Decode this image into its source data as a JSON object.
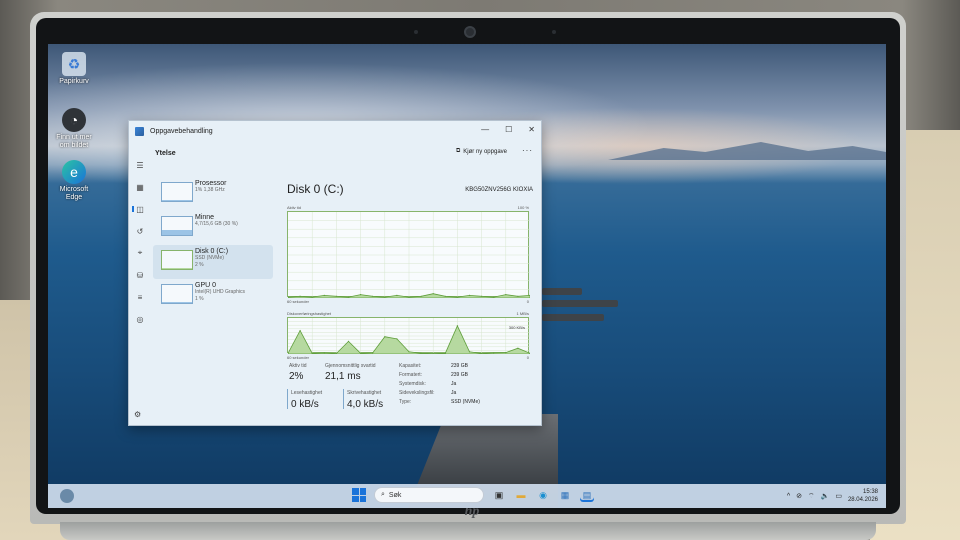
{
  "desktop": {
    "icons": [
      {
        "label": "Papirkurv",
        "icon": "recycle-bin-icon"
      },
      {
        "label": "Finn ut mer om bildet",
        "icon": "spotlight-icon"
      },
      {
        "label": "Microsoft Edge",
        "icon": "edge-icon"
      }
    ]
  },
  "task_manager": {
    "title": "Oppgavebehandling",
    "window_controls": [
      "—",
      "☐",
      "✕"
    ],
    "section_title": "Ytelse",
    "run_task": "Kjør ny oppgave",
    "more": "···",
    "rail_icons": [
      "☰",
      "▦",
      "◫",
      "↺",
      "⌖",
      "⛁",
      "≡",
      "◎"
    ],
    "settings_icon": "⚙",
    "items": [
      {
        "name": "Prosessor",
        "sub1": "1% 1,38 GHz",
        "sub2": "",
        "level": 0.01
      },
      {
        "name": "Minne",
        "sub1": "4,7/15,6 GB (30 %)",
        "sub2": "",
        "level": 0.3
      },
      {
        "name": "Disk 0 (C:)",
        "sub1": "SSD (NVMe)",
        "sub2": "2 %",
        "level": 0.02
      },
      {
        "name": "GPU 0",
        "sub1": "Intel(R) UHD Graphics",
        "sub2": "1 %",
        "level": 0.01
      }
    ],
    "disk": {
      "title": "Disk 0 (C:)",
      "model": "KBG50ZNV256G KIOXIA",
      "active_time_label": "Aktiv tid",
      "active_time_max": "100 %",
      "axis_left": "60 sekunder",
      "axis_right_zero": "0",
      "transfer_label": "Diskoverføringshastighet",
      "transfer_max": "1 MB/s",
      "transfer_mid": "300 KB/s",
      "stats": {
        "aktiv_tid_label": "Aktiv tid",
        "aktiv_tid": "2%",
        "avg_resp_label": "Gjennomsnittlig svartid",
        "avg_resp": "21,1 ms",
        "read_label": "Lesehastighet",
        "read": "0 kB/s",
        "write_label": "Skrivehastighet",
        "write": "4,0 kB/s"
      },
      "props": [
        {
          "k": "Kapasitet:",
          "v": "239 GB"
        },
        {
          "k": "Formatert:",
          "v": "239 GB"
        },
        {
          "k": "Systemdisk:",
          "v": "Ja"
        },
        {
          "k": "Sidevekslingsfil:",
          "v": "Ja"
        },
        {
          "k": "Type:",
          "v": "SSD (NVMe)"
        }
      ]
    }
  },
  "chart_data": [
    {
      "type": "area",
      "title": "Aktiv tid",
      "ylim": [
        0,
        100
      ],
      "xlabel": "60 sekunder",
      "x": [
        0,
        3,
        6,
        9,
        12,
        15,
        18,
        21,
        24,
        27,
        30,
        33,
        36,
        39,
        42,
        45,
        48,
        51,
        54,
        57,
        60
      ],
      "values": [
        1,
        2,
        1,
        3,
        2,
        1,
        4,
        2,
        1,
        3,
        1,
        2,
        5,
        2,
        1,
        3,
        2,
        1,
        4,
        2,
        3
      ]
    },
    {
      "type": "area",
      "title": "Diskoverføringshastighet",
      "ylim": [
        0,
        1000
      ],
      "xlabel": "60 sekunder",
      "x": [
        0,
        3,
        6,
        9,
        12,
        15,
        18,
        21,
        24,
        27,
        30,
        33,
        36,
        39,
        42,
        45,
        48,
        51,
        54,
        57,
        60
      ],
      "values": [
        20,
        650,
        20,
        30,
        15,
        350,
        20,
        30,
        480,
        420,
        60,
        20,
        15,
        20,
        780,
        60,
        15,
        30,
        40,
        160,
        20
      ]
    }
  ],
  "taskbar": {
    "search_placeholder": "Søk",
    "apps": [
      {
        "icon": "task-view-icon",
        "glyph": "▣",
        "color": "#333333"
      },
      {
        "icon": "file-explorer-icon",
        "glyph": "▬",
        "color": "#e0a93a"
      },
      {
        "icon": "edge-icon",
        "glyph": "◉",
        "color": "#1a8fd0"
      },
      {
        "icon": "store-icon",
        "glyph": "▦",
        "color": "#2a6fba"
      },
      {
        "icon": "task-manager-icon",
        "glyph": "▤",
        "color": "#2a6fba"
      }
    ],
    "tray": [
      "^",
      "⊘",
      "⌔",
      "🔈",
      "▭"
    ],
    "time": "15:38",
    "date": "28.04.2026"
  },
  "colors": {
    "accent": "#1a73d9",
    "chart_line": "#5f9e3b",
    "chart_fill": "#b6d9a0",
    "window_bg": "#e7f0f7"
  }
}
